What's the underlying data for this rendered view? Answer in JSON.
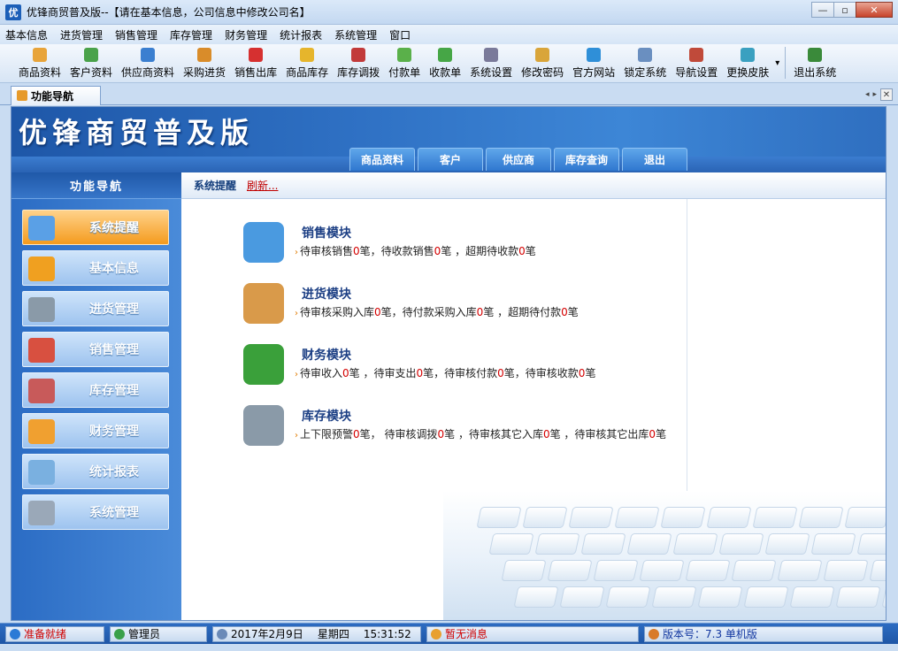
{
  "window": {
    "app_icon_text": "优",
    "title": "优锋商贸普及版--【请在基本信息，公司信息中修改公司名】",
    "minimize": "—",
    "maximize": "▫",
    "close": "✕"
  },
  "menu": [
    "基本信息",
    "进货管理",
    "销售管理",
    "库存管理",
    "财务管理",
    "统计报表",
    "系统管理",
    "窗口"
  ],
  "toolbar": [
    {
      "label": "商品资料",
      "color": "#e8a43a",
      "icon": "goods-icon"
    },
    {
      "label": "客户资料",
      "color": "#4aa24a",
      "icon": "customer-icon"
    },
    {
      "label": "供应商资料",
      "color": "#3b7fd0",
      "icon": "supplier-icon"
    },
    {
      "label": "采购进货",
      "color": "#d98c2a",
      "icon": "purchase-icon"
    },
    {
      "label": "销售出库",
      "color": "#d63030",
      "icon": "sales-icon"
    },
    {
      "label": "商品库存",
      "color": "#e6b52c",
      "icon": "stock-icon"
    },
    {
      "label": "库存调拨",
      "color": "#c23a3a",
      "icon": "transfer-icon"
    },
    {
      "label": "付款单",
      "color": "#5ab04a",
      "icon": "payment-icon"
    },
    {
      "label": "收款单",
      "color": "#46a646",
      "icon": "receipt-icon"
    },
    {
      "label": "系统设置",
      "color": "#7a7a9a",
      "icon": "settings-icon"
    },
    {
      "label": "修改密码",
      "color": "#d9a53a",
      "icon": "key-icon"
    },
    {
      "label": "官方网站",
      "color": "#2f8fd8",
      "icon": "ie-icon"
    },
    {
      "label": "锁定系统",
      "color": "#6a8fc0",
      "icon": "lock-icon"
    },
    {
      "label": "导航设置",
      "color": "#c04a3a",
      "icon": "navigation-icon"
    },
    {
      "label": "更换皮肤",
      "color": "#3aa0c0",
      "icon": "skin-icon"
    }
  ],
  "toolbar_more": "▾",
  "toolbar_exit": {
    "label": "退出系统",
    "color": "#3a8a3a",
    "icon": "exit-icon"
  },
  "tab": {
    "label": "功能导航",
    "nav_left": "◂",
    "nav_right": "▸",
    "close": "✕"
  },
  "banner": {
    "title": "优锋商贸普及版",
    "tabs": [
      "商品资料",
      "客户",
      "供应商",
      "库存查询",
      "退出"
    ]
  },
  "leftnav": {
    "header": "功能导航",
    "items": [
      {
        "label": "系统提醒",
        "color": "#5aa0e6",
        "icon": "reminder-icon",
        "active": true
      },
      {
        "label": "基本信息",
        "color": "#f0a020",
        "icon": "info-icon"
      },
      {
        "label": "进货管理",
        "color": "#8a9aa8",
        "icon": "cart-in-icon"
      },
      {
        "label": "销售管理",
        "color": "#d85040",
        "icon": "cart-out-icon"
      },
      {
        "label": "库存管理",
        "color": "#c85a5a",
        "icon": "warehouse-icon"
      },
      {
        "label": "财务管理",
        "color": "#f0a030",
        "icon": "finance-icon"
      },
      {
        "label": "统计报表",
        "color": "#7ab0e0",
        "icon": "report-icon"
      },
      {
        "label": "系统管理",
        "color": "#9aa8b8",
        "icon": "gear-icon"
      }
    ]
  },
  "content": {
    "header": "系统提醒",
    "refresh": "刷新...",
    "arrow": "›",
    "modules": [
      {
        "title": "销售模块",
        "color": "#4a9ae0",
        "icon": "sales-module-icon",
        "parts": [
          [
            "待审核销售",
            "0",
            "笔，待收款销售"
          ],
          [
            "",
            "0",
            "笔 ，超期待收款"
          ],
          [
            "",
            "0",
            "笔"
          ]
        ]
      },
      {
        "title": "进货模块",
        "color": "#d99a4a",
        "icon": "purchase-module-icon",
        "parts": [
          [
            "待审核采购入库",
            "0",
            "笔，待付款采购入库"
          ],
          [
            "",
            "0",
            "笔 ，超期待付款"
          ],
          [
            "",
            "0",
            "笔"
          ]
        ]
      },
      {
        "title": "财务模块",
        "color": "#3aa03a",
        "icon": "finance-module-icon",
        "parts": [
          [
            "待审收入",
            "0",
            "笔 ，待审支出"
          ],
          [
            "",
            "0",
            "笔，待审核付款"
          ],
          [
            "",
            "0",
            "笔，待审核收款"
          ],
          [
            "",
            "0",
            "笔"
          ]
        ]
      },
      {
        "title": "库存模块",
        "color": "#8a9aa8",
        "icon": "stock-module-icon",
        "parts": [
          [
            "上下限预警",
            "0",
            "笔， 待审核调拨"
          ],
          [
            "",
            "0",
            "笔 ，待审核其它入库"
          ],
          [
            "",
            "0",
            "笔 ，待审核其它出库"
          ],
          [
            "",
            "0",
            "笔"
          ]
        ]
      }
    ]
  },
  "status": {
    "ready": "准备就绪",
    "user": "管理员",
    "date": "2017年2月9日",
    "weekday": "星期四",
    "time": "15:31:52",
    "message": "暂无消息",
    "version": "版本号：7.3 单机版"
  }
}
